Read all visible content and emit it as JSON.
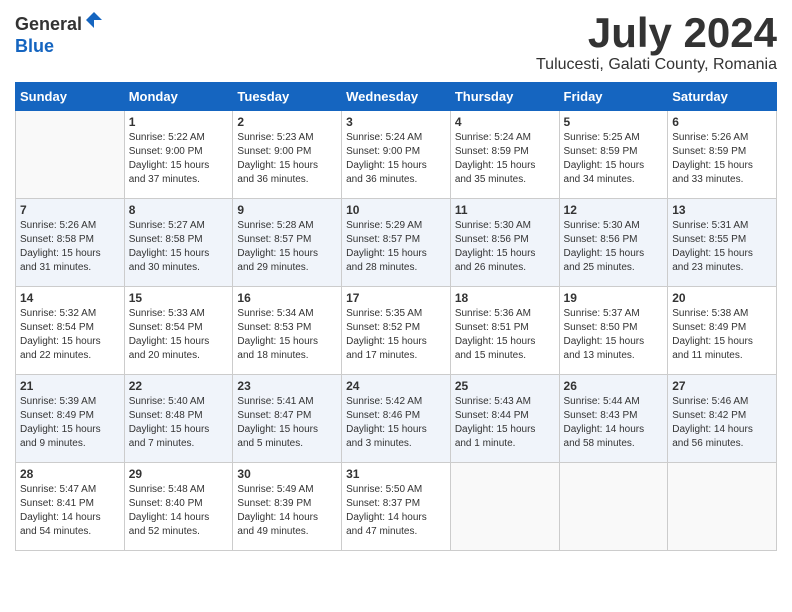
{
  "header": {
    "logo_general": "General",
    "logo_blue": "Blue",
    "month": "July 2024",
    "location": "Tulucesti, Galati County, Romania"
  },
  "weekdays": [
    "Sunday",
    "Monday",
    "Tuesday",
    "Wednesday",
    "Thursday",
    "Friday",
    "Saturday"
  ],
  "weeks": [
    [
      {
        "day": "",
        "empty": true
      },
      {
        "day": "1",
        "sunrise": "5:22 AM",
        "sunset": "9:00 PM",
        "daylight": "15 hours and 37 minutes."
      },
      {
        "day": "2",
        "sunrise": "5:23 AM",
        "sunset": "9:00 PM",
        "daylight": "15 hours and 36 minutes."
      },
      {
        "day": "3",
        "sunrise": "5:24 AM",
        "sunset": "9:00 PM",
        "daylight": "15 hours and 36 minutes."
      },
      {
        "day": "4",
        "sunrise": "5:24 AM",
        "sunset": "8:59 PM",
        "daylight": "15 hours and 35 minutes."
      },
      {
        "day": "5",
        "sunrise": "5:25 AM",
        "sunset": "8:59 PM",
        "daylight": "15 hours and 34 minutes."
      },
      {
        "day": "6",
        "sunrise": "5:26 AM",
        "sunset": "8:59 PM",
        "daylight": "15 hours and 33 minutes."
      }
    ],
    [
      {
        "day": "7",
        "sunrise": "5:26 AM",
        "sunset": "8:58 PM",
        "daylight": "15 hours and 31 minutes."
      },
      {
        "day": "8",
        "sunrise": "5:27 AM",
        "sunset": "8:58 PM",
        "daylight": "15 hours and 30 minutes."
      },
      {
        "day": "9",
        "sunrise": "5:28 AM",
        "sunset": "8:57 PM",
        "daylight": "15 hours and 29 minutes."
      },
      {
        "day": "10",
        "sunrise": "5:29 AM",
        "sunset": "8:57 PM",
        "daylight": "15 hours and 28 minutes."
      },
      {
        "day": "11",
        "sunrise": "5:30 AM",
        "sunset": "8:56 PM",
        "daylight": "15 hours and 26 minutes."
      },
      {
        "day": "12",
        "sunrise": "5:30 AM",
        "sunset": "8:56 PM",
        "daylight": "15 hours and 25 minutes."
      },
      {
        "day": "13",
        "sunrise": "5:31 AM",
        "sunset": "8:55 PM",
        "daylight": "15 hours and 23 minutes."
      }
    ],
    [
      {
        "day": "14",
        "sunrise": "5:32 AM",
        "sunset": "8:54 PM",
        "daylight": "15 hours and 22 minutes."
      },
      {
        "day": "15",
        "sunrise": "5:33 AM",
        "sunset": "8:54 PM",
        "daylight": "15 hours and 20 minutes."
      },
      {
        "day": "16",
        "sunrise": "5:34 AM",
        "sunset": "8:53 PM",
        "daylight": "15 hours and 18 minutes."
      },
      {
        "day": "17",
        "sunrise": "5:35 AM",
        "sunset": "8:52 PM",
        "daylight": "15 hours and 17 minutes."
      },
      {
        "day": "18",
        "sunrise": "5:36 AM",
        "sunset": "8:51 PM",
        "daylight": "15 hours and 15 minutes."
      },
      {
        "day": "19",
        "sunrise": "5:37 AM",
        "sunset": "8:50 PM",
        "daylight": "15 hours and 13 minutes."
      },
      {
        "day": "20",
        "sunrise": "5:38 AM",
        "sunset": "8:49 PM",
        "daylight": "15 hours and 11 minutes."
      }
    ],
    [
      {
        "day": "21",
        "sunrise": "5:39 AM",
        "sunset": "8:49 PM",
        "daylight": "15 hours and 9 minutes."
      },
      {
        "day": "22",
        "sunrise": "5:40 AM",
        "sunset": "8:48 PM",
        "daylight": "15 hours and 7 minutes."
      },
      {
        "day": "23",
        "sunrise": "5:41 AM",
        "sunset": "8:47 PM",
        "daylight": "15 hours and 5 minutes."
      },
      {
        "day": "24",
        "sunrise": "5:42 AM",
        "sunset": "8:46 PM",
        "daylight": "15 hours and 3 minutes."
      },
      {
        "day": "25",
        "sunrise": "5:43 AM",
        "sunset": "8:44 PM",
        "daylight": "15 hours and 1 minute."
      },
      {
        "day": "26",
        "sunrise": "5:44 AM",
        "sunset": "8:43 PM",
        "daylight": "14 hours and 58 minutes."
      },
      {
        "day": "27",
        "sunrise": "5:46 AM",
        "sunset": "8:42 PM",
        "daylight": "14 hours and 56 minutes."
      }
    ],
    [
      {
        "day": "28",
        "sunrise": "5:47 AM",
        "sunset": "8:41 PM",
        "daylight": "14 hours and 54 minutes."
      },
      {
        "day": "29",
        "sunrise": "5:48 AM",
        "sunset": "8:40 PM",
        "daylight": "14 hours and 52 minutes."
      },
      {
        "day": "30",
        "sunrise": "5:49 AM",
        "sunset": "8:39 PM",
        "daylight": "14 hours and 49 minutes."
      },
      {
        "day": "31",
        "sunrise": "5:50 AM",
        "sunset": "8:37 PM",
        "daylight": "14 hours and 47 minutes."
      },
      {
        "day": "",
        "empty": true
      },
      {
        "day": "",
        "empty": true
      },
      {
        "day": "",
        "empty": true
      }
    ]
  ]
}
